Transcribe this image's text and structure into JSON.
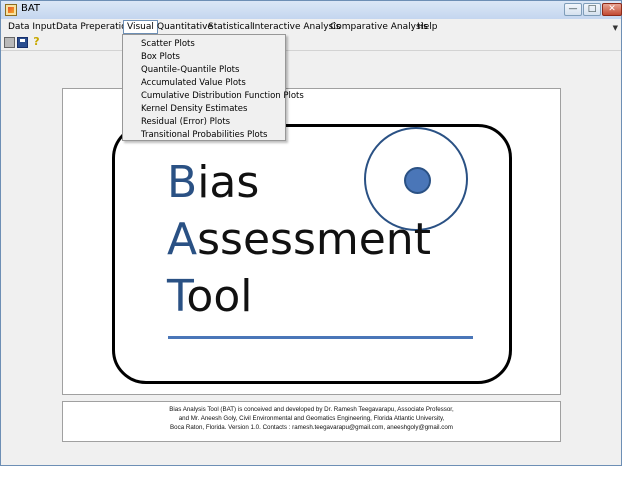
{
  "window": {
    "title": "BAT"
  },
  "menubar": {
    "items": [
      {
        "label": "Data Input"
      },
      {
        "label": "Data Preperation"
      },
      {
        "label": "Visual"
      },
      {
        "label": "Quantitative"
      },
      {
        "label": "Statistical"
      },
      {
        "label": "Interactive Analysis"
      },
      {
        "label": "Comparative Analysis"
      },
      {
        "label": "Help"
      }
    ]
  },
  "visual_menu": {
    "items": [
      {
        "label": "Scatter Plots"
      },
      {
        "label": "Box Plots"
      },
      {
        "label": "Quantile-Quantile Plots"
      },
      {
        "label": "Accumulated Value Plots"
      },
      {
        "label": "Cumulative Distribution Function Plots"
      },
      {
        "label": "Kernel Density Estimates"
      },
      {
        "label": "Residual (Error) Plots"
      },
      {
        "label": "Transitional Probabilities Plots"
      }
    ]
  },
  "logo": {
    "line1": {
      "initial": "B",
      "rest": "ias"
    },
    "line2": {
      "initial": "A",
      "rest": "ssessment"
    },
    "line3": {
      "initial": "T",
      "rest": "ool"
    },
    "accent_color": "#2a5184"
  },
  "credits": {
    "line1": "Bias Analysis Tool (BAT)  is conceived and developed by Dr. Ramesh Teegavarapu, Associate Professor,",
    "line2": "and Mr. Aneesh Goly, Civil Environmental and Geomatics Engineering, Florida Atlantic University,",
    "line3": "Boca Raton, Florida. Version 1.0. Contacts : ramesh.teegavarapu@gmail.com, aneeshgoly@gmail.com"
  }
}
